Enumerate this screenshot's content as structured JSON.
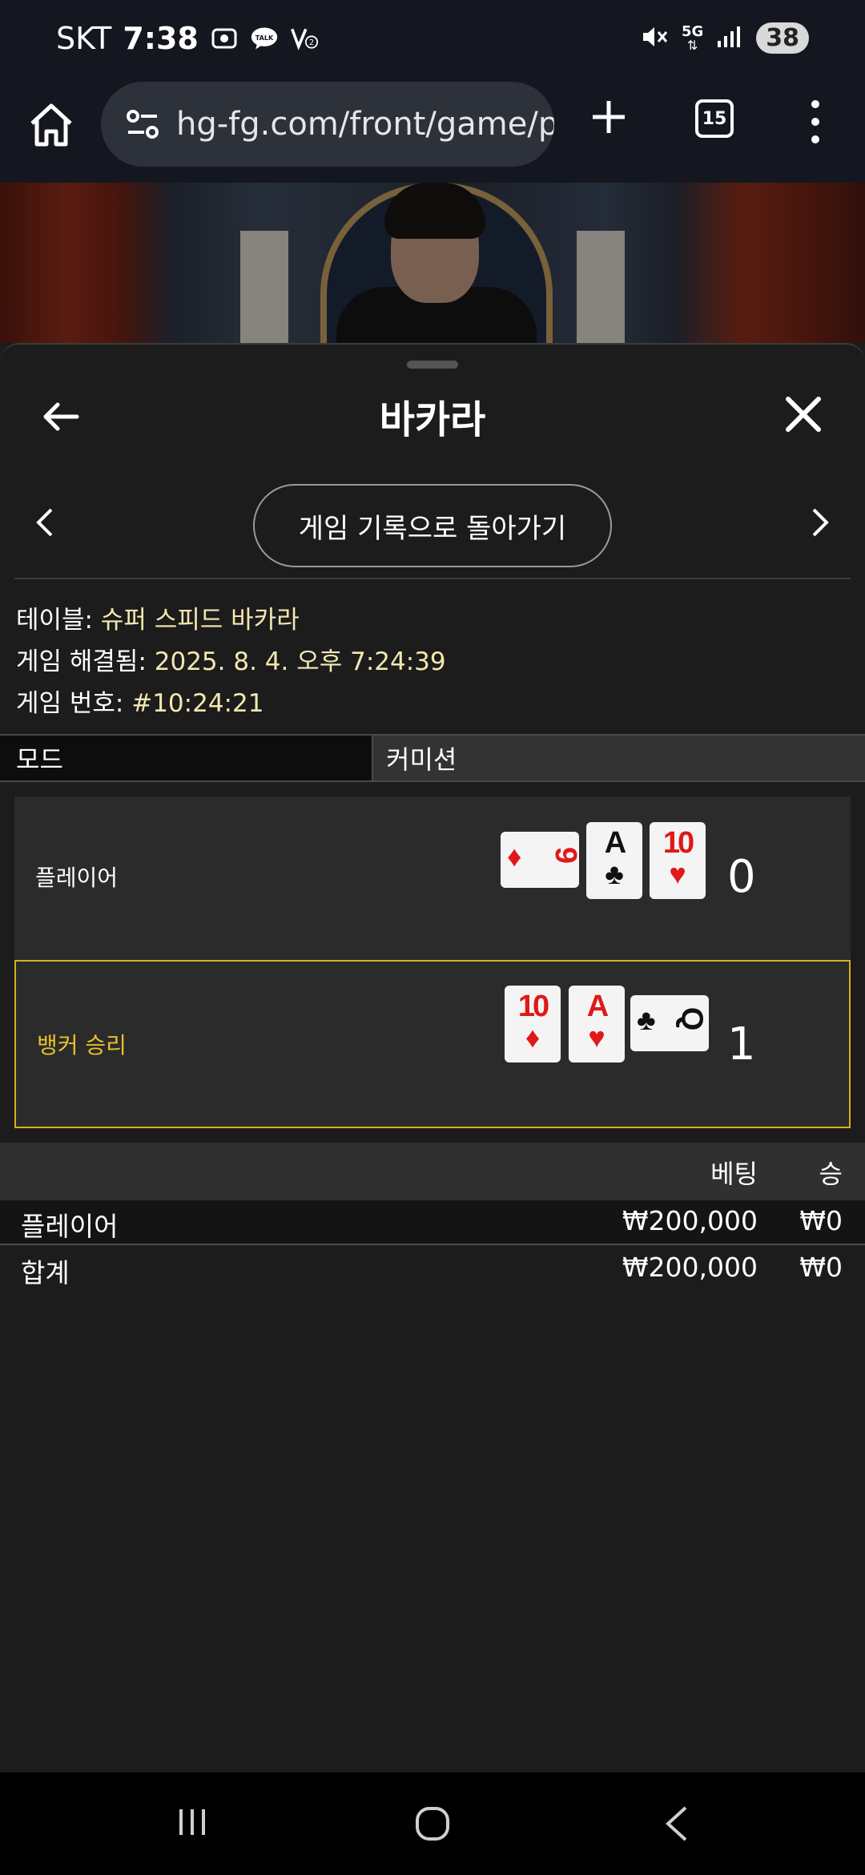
{
  "status_bar": {
    "carrier": "SKT",
    "time": "7:38",
    "network": "5G",
    "battery": "38"
  },
  "browser": {
    "url": "hg-fg.com/front/game/p",
    "tab_count": "15"
  },
  "sheet": {
    "title": "바카라",
    "history_button": "게임 기록으로 돌아가기"
  },
  "info": {
    "table_label": "테이블: ",
    "table_value": "슈퍼 스피드 바카라",
    "settled_label": "게임 해결됨: ",
    "settled_value": "2025. 8. 4. 오후 7:24:39",
    "game_no_label": "게임 번호: ",
    "game_no_value": "#10:24:21"
  },
  "tabs": {
    "mode": "모드",
    "commission": "커미션"
  },
  "hands": {
    "player": {
      "label": "플레이어",
      "score": "0",
      "cards": [
        {
          "rank": "9",
          "suit": "♦",
          "color": "#e01818",
          "orientation": "horizontal"
        },
        {
          "rank": "A",
          "suit": "♣",
          "color": "#111111",
          "orientation": "vertical"
        },
        {
          "rank": "10",
          "suit": "♥",
          "color": "#e01818",
          "orientation": "vertical"
        }
      ]
    },
    "banker": {
      "label": "뱅커 승리",
      "score": "1",
      "highlight_color": "#d4b020",
      "cards": [
        {
          "rank": "10",
          "suit": "♦",
          "color": "#e01818",
          "orientation": "vertical"
        },
        {
          "rank": "A",
          "suit": "♥",
          "color": "#e01818",
          "orientation": "vertical"
        },
        {
          "rank": "Q",
          "suit": "♣",
          "color": "#111111",
          "orientation": "horizontal"
        }
      ]
    }
  },
  "bets": {
    "header_bet": "베팅",
    "header_win": "승",
    "rows": [
      {
        "name": "플레이어",
        "bet": "₩200,000",
        "win": "₩0"
      }
    ],
    "total": {
      "name": "합계",
      "bet": "₩200,000",
      "win": "₩0"
    }
  },
  "icons": {
    "home": "home-icon",
    "site_settings": "tune-icon",
    "new_tab": "plus-icon",
    "tabs": "tabs-icon",
    "more": "more-vert-icon",
    "back": "arrow-left-icon",
    "close": "close-icon",
    "prev": "chevron-left-icon",
    "next": "chevron-right-icon"
  }
}
